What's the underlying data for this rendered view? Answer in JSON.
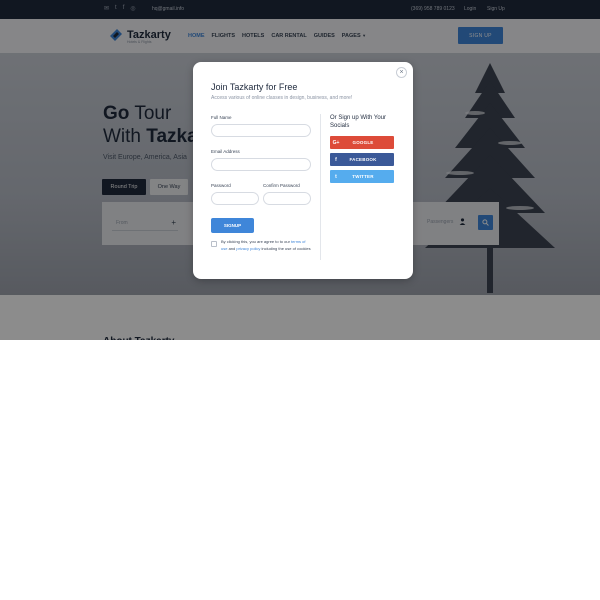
{
  "topbar": {
    "social_icons": [
      "mail-icon",
      "twitter-icon",
      "facebook-icon",
      "instagram-icon"
    ],
    "email": "hq@gmail.info",
    "phone": "(369) 958 789 0123",
    "login": "Login",
    "signup": "Sign Up"
  },
  "navbar": {
    "brand": "Tazkarty",
    "tagline": "Hotels & Flights",
    "items": [
      "HOME",
      "FLIGHTS",
      "HOTELS",
      "CAR RENTAL",
      "GUIDES",
      "PAGES"
    ],
    "active_item": "HOME",
    "signup_button": "SIGN UP"
  },
  "hero": {
    "title_line1_bold": "Go",
    "title_line1_rest": " Tour",
    "title_line2_rest": "With ",
    "title_line2_bold": "Tazkarty",
    "subtitle": "Visit Europe, America, Asia",
    "tabs": [
      "Round Trip",
      "One Way"
    ],
    "from_placeholder": "From",
    "passengers_placeholder": "Passengers"
  },
  "about": {
    "title": "About Tazkarty"
  },
  "modal": {
    "title": "Join Tazkarty for Free",
    "subtitle": "Access various of online classes in design, business, and more!",
    "fields": {
      "full_name": "Full Name",
      "email": "Email Address",
      "password": "Password",
      "confirm_password": "Confirm Password"
    },
    "submit": "SIGNUP",
    "terms_prefix": "By clicking this, you are agree to to our ",
    "terms_link": "terms of use",
    "terms_mid": " and ",
    "privacy_link": "privacy policy",
    "terms_suffix": " including the use of cookies",
    "socials_title": "Or Sign up With Your Socials",
    "social_buttons": [
      {
        "label": "GOOGLE",
        "icon": "G+"
      },
      {
        "label": "FACEBOOK",
        "icon": "f"
      },
      {
        "label": "TWITTER",
        "icon": "t"
      }
    ],
    "close": "×"
  },
  "colors": {
    "accent": "#3f86d9",
    "dark": "#1f2a3d",
    "google": "#dd4b39",
    "facebook": "#3b5998",
    "twitter": "#55acee"
  }
}
